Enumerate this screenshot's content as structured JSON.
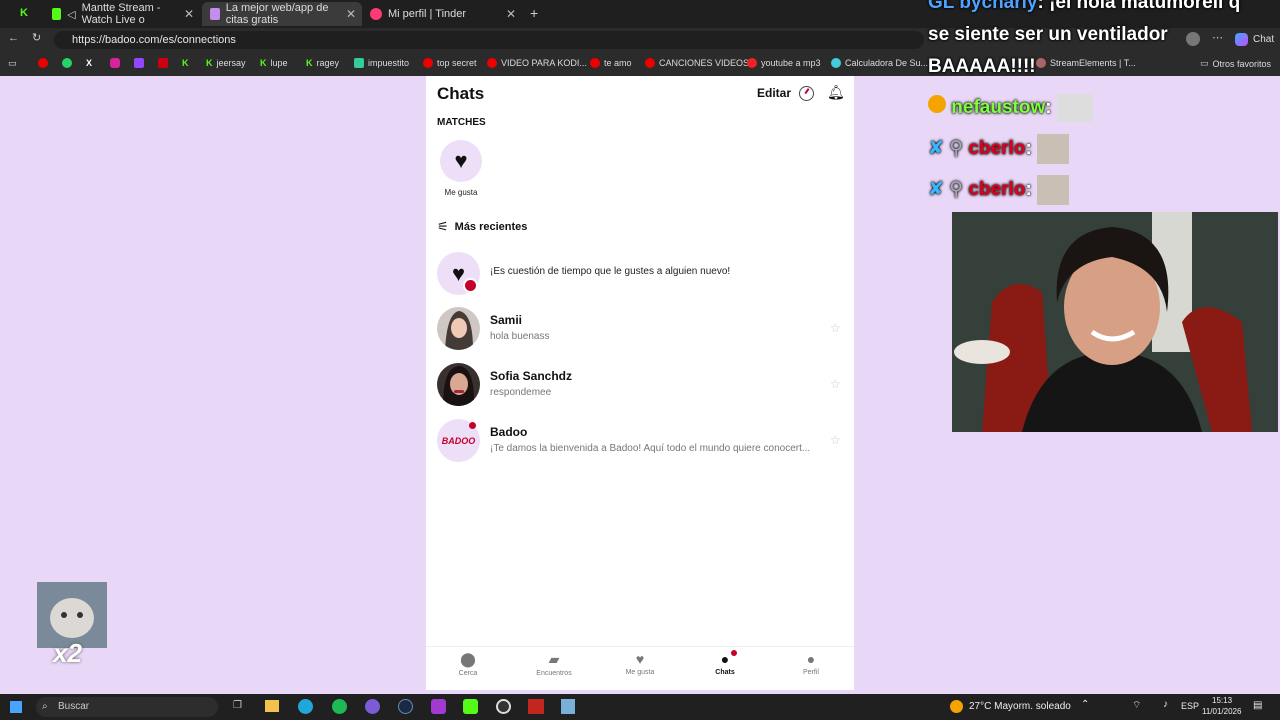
{
  "browser": {
    "tabs": [
      {
        "label": "Mantte Stream - Watch Live o"
      },
      {
        "label": "La mejor web/app de citas gratis"
      },
      {
        "label": "Mi perfil | Tinder"
      }
    ],
    "url": "https://badoo.com/es/connections",
    "bookmarks": [
      "jeersay",
      "lupe",
      "ragey",
      "impuestito",
      "top secret",
      "VIDEO PARA KODI...",
      "te amo",
      "CANCIONES VIDEOS",
      "youtube a mp3",
      "Calculadora De Su...",
      "StreamElements | T...",
      "Otros favoritos"
    ],
    "chat_label": "Chat"
  },
  "chats": {
    "title": "Chats",
    "edit": "Editar",
    "matches_label": "MATCHES",
    "like_label": "Me gusta",
    "recent_label": "Más recientes",
    "promo": "¡Es cuestión de tiempo que le gustes a alguien nuevo!",
    "conversations": [
      {
        "name": "Samii",
        "message": "hola buenass"
      },
      {
        "name": "Sofia Sanchdz",
        "message": "respondemee"
      },
      {
        "name": "Badoo",
        "message": "¡Te damos la bienvenida a Badoo! Aquí todo el mundo quiere conocert..."
      }
    ],
    "badoo_logo": "BADOO"
  },
  "nav": [
    {
      "label": "Cerca",
      "icon": "location-icon"
    },
    {
      "label": "Encuentros",
      "icon": "cards-icon"
    },
    {
      "label": "Me gusta",
      "icon": "heart-icon"
    },
    {
      "label": "Chats",
      "icon": "chat-icon"
    },
    {
      "label": "Perfil",
      "icon": "profile-icon"
    }
  ],
  "overlay": {
    "line1_user": "bycharly",
    "line1_text": ": ¡el hola matumorell q",
    "line2": "se siente ser un ventilador",
    "line3": "BAAAAA!!!!",
    "line4_user": "nefaustow",
    "line5_user": "cberlo",
    "line6_user": "cberlo",
    "badge": "x2"
  },
  "taskbar": {
    "search": "Buscar",
    "weather": "27°C  Mayorm. soleado",
    "lang": "ESP",
    "time": "15:13",
    "date": "11/01/2026"
  }
}
